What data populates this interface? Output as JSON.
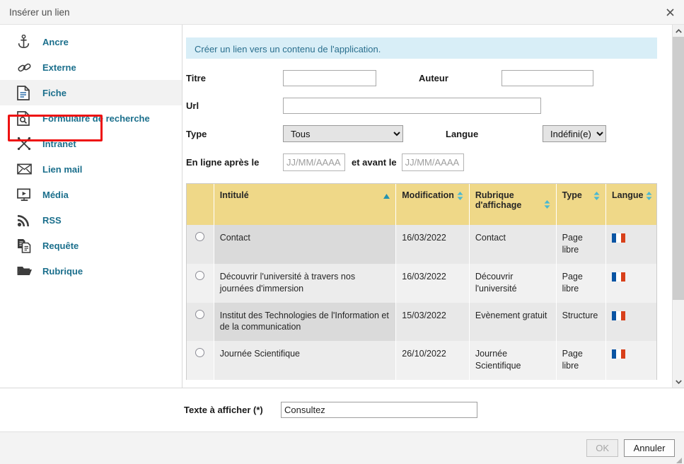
{
  "window": {
    "title": "Insérer un lien",
    "close_icon": "close-icon"
  },
  "sidebar": {
    "items": [
      {
        "label": "Ancre",
        "icon": "anchor-icon",
        "selected": false
      },
      {
        "label": "Externe",
        "icon": "chain-link-icon",
        "selected": false
      },
      {
        "label": "Fiche",
        "icon": "document-icon",
        "selected": true
      },
      {
        "label": "Formulaire de recherche",
        "icon": "search-form-icon",
        "selected": false
      },
      {
        "label": "Intranet",
        "icon": "network-icon",
        "selected": false
      },
      {
        "label": "Lien mail",
        "icon": "envelope-icon",
        "selected": false
      },
      {
        "label": "Média",
        "icon": "media-player-icon",
        "selected": false
      },
      {
        "label": "RSS",
        "icon": "rss-icon",
        "selected": false
      },
      {
        "label": "Requête",
        "icon": "copy-docs-icon",
        "selected": false
      },
      {
        "label": "Rubrique",
        "icon": "folder-icon",
        "selected": false
      }
    ],
    "focus_ring_on": "Fiche"
  },
  "main": {
    "info_message": "Créer un lien vers un contenu de l'application.",
    "fields": {
      "titre_label": "Titre",
      "titre_value": "",
      "titre_placeholder": "",
      "auteur_label": "Auteur",
      "auteur_value": "",
      "auteur_placeholder": "",
      "url_label": "Url",
      "url_value": "",
      "url_placeholder": "",
      "type_label": "Type",
      "type_value": "Tous",
      "type_options": [
        "Tous"
      ],
      "langue_label": "Langue",
      "langue_value": "Indéfini(e)",
      "langue_options": [
        "Indéfini(e)"
      ],
      "enligne_label": "En ligne après le",
      "enligne_value": "",
      "enligne_placeholder": "JJ/MM/AAAA",
      "avant_label": "et avant le",
      "avant_value": "",
      "avant_placeholder": "JJ/MM/AAAA"
    },
    "table": {
      "columns": [
        {
          "key": "radio",
          "label": "",
          "sort": "none"
        },
        {
          "key": "title",
          "label": "Intitulé",
          "sort": "asc"
        },
        {
          "key": "mod",
          "label": "Modification",
          "sort": "both"
        },
        {
          "key": "rub",
          "label": "Rubrique d'affichage",
          "sort": "both"
        },
        {
          "key": "type",
          "label": "Type",
          "sort": "both"
        },
        {
          "key": "lang",
          "label": "Langue",
          "sort": "both"
        }
      ],
      "rows": [
        {
          "title": "Contact",
          "mod": "16/03/2022",
          "rub": "Contact",
          "type": "Page libre",
          "lang": "fr-flag-icon",
          "selected": false
        },
        {
          "title": "Découvrir l'université à travers nos journées d'immersion",
          "mod": "16/03/2022",
          "rub": "Découvrir l'université",
          "type": "Page libre",
          "lang": "fr-flag-icon",
          "selected": false
        },
        {
          "title": "Institut des Technologies de l'Information et de la communication",
          "mod": "15/03/2022",
          "rub": "Evènement gratuit",
          "type": "Structure",
          "lang": "fr-flag-icon",
          "selected": false
        },
        {
          "title": "Journée Scientifique",
          "mod": "26/10/2022",
          "rub": "Journée Scientifique",
          "type": "Page libre",
          "lang": "fr-flag-icon",
          "selected": false
        }
      ]
    },
    "scrollbar": {
      "up_arrow": "chevron-up-icon",
      "down_arrow": "chevron-down-icon"
    }
  },
  "bottom": {
    "texte_label": "Texte à afficher (*)",
    "texte_value": "Consultez",
    "texte_placeholder": ""
  },
  "footer": {
    "ok_label": "OK",
    "ok_enabled": false,
    "cancel_label": "Annuler",
    "cancel_enabled": true
  },
  "colors": {
    "link_blue": "#1b6f8c",
    "info_bg": "#d8eef7",
    "table_header": "#efd888",
    "focus_red": "#ee1111",
    "flag_blue": "#0b55a4",
    "flag_red": "#d8401a"
  }
}
